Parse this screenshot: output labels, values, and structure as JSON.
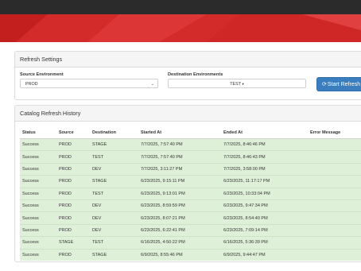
{
  "refresh_settings": {
    "title": "Refresh Settings",
    "source_label": "Source Environment",
    "source_value": "PROD",
    "destination_label": "Destination Environments",
    "destination_value": "TEST",
    "refresh_button": "Start Refresh"
  },
  "history": {
    "title": "Catalog Refresh History",
    "columns": [
      "Status",
      "Source",
      "Destination",
      "Started At",
      "Ended At",
      "Error Message"
    ],
    "rows": [
      [
        "Success",
        "PROD",
        "STAGE",
        "7/7/2025, 7:57:40 PM",
        "7/7/2025, 8:46:46 PM",
        ""
      ],
      [
        "Success",
        "PROD",
        "TEST",
        "7/7/2025, 7:57:40 PM",
        "7/7/2025, 8:46:43 PM",
        ""
      ],
      [
        "Success",
        "PROD",
        "DEV",
        "7/7/2025, 3:11:27 PM",
        "7/7/2025, 3:58:00 PM",
        ""
      ],
      [
        "Success",
        "PROD",
        "STAGE",
        "6/23/2025, 9:15:11 PM",
        "6/23/2025, 11:17:17 PM",
        ""
      ],
      [
        "Success",
        "PROD",
        "TEST",
        "6/23/2025, 9:13:01 PM",
        "6/23/2025, 10:33:04 PM",
        ""
      ],
      [
        "Success",
        "PROD",
        "DEV",
        "6/23/2025, 8:59:59 PM",
        "6/23/2025, 9:47:34 PM",
        ""
      ],
      [
        "Success",
        "PROD",
        "DEV",
        "6/23/2025, 8:07:21 PM",
        "6/23/2025, 8:54:40 PM",
        ""
      ],
      [
        "Success",
        "PROD",
        "DEV",
        "6/23/2025, 6:22:41 PM",
        "6/23/2025, 7:09:14 PM",
        ""
      ],
      [
        "Success",
        "STAGE",
        "TEST",
        "6/16/2025, 4:50:22 PM",
        "6/16/2025, 5:36:39 PM",
        ""
      ],
      [
        "Success",
        "PROD",
        "STAGE",
        "6/9/2025, 8:55:46 PM",
        "6/9/2025, 9:44:47 PM",
        ""
      ]
    ]
  },
  "colors": {
    "brand_red": "#d32a2a",
    "topbar": "#2b2b2b",
    "button_blue": "#3a7ebf",
    "success_row": "#dff0d8"
  },
  "icons": {
    "refresh": "refresh-icon",
    "caret": "chevron-down-icon"
  }
}
